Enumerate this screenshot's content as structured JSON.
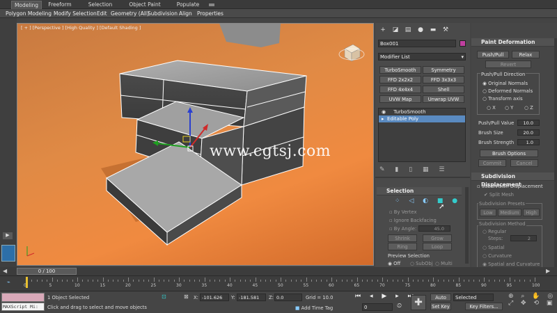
{
  "ribbon": {
    "tabs": [
      "Modeling",
      "Freeform",
      "Selection",
      "Object Paint",
      "Populate"
    ],
    "subtabs": [
      "Polygon Modeling",
      "Modify Selection",
      "Edit",
      "Geometry (All)",
      "Subdivision",
      "Align",
      "Properties"
    ]
  },
  "viewport": {
    "label": "[ + ] [Perspective ] [High Quality ] [Default Shading ]"
  },
  "watermark": "www.cgtsj.com",
  "command_panel": {
    "object_name": "Box001",
    "object_color": "#c040a0",
    "modifier_list": "Modifier List",
    "modifier_buttons": [
      "TurboSmooth",
      "Symmetry",
      "FFD 2x2x2",
      "FFD 3x3x3",
      "FFD 4x4x4",
      "Shell",
      "UVW Map",
      "Unwrap UVW"
    ],
    "stack": [
      "TurboSmooth",
      "Editable Poly"
    ],
    "selection": {
      "title": "Selection",
      "by_vertex": "By Vertex",
      "ignore_backfacing": "Ignore Backfacing",
      "by_angle": "By Angle:",
      "angle": "45.0",
      "shrink": "Shrink",
      "grow": "Grow",
      "ring": "Ring",
      "loop": "Loop",
      "preview": "Preview Selection",
      "preview_opts": [
        "Off",
        "SubObj",
        "Multi"
      ]
    }
  },
  "paint_deformation": {
    "title": "Paint Deformation",
    "push_pull": "Push/Pull",
    "relax": "Relax",
    "revert": "Revert",
    "direction": "Push/Pull Direction",
    "original": "Original Normals",
    "deformed": "Deformed Normals",
    "transform": "Transform axis",
    "axes": [
      "X",
      "Y",
      "Z"
    ],
    "value_label": "Push/Pull Value",
    "value": "10.0",
    "size_label": "Brush Size",
    "size": "20.0",
    "strength_label": "Brush Strength",
    "strength": "1.0",
    "options": "Brush Options",
    "commit": "Commit",
    "cancel": "Cancel"
  },
  "subdivision": {
    "title": "Subdivision Displacement",
    "check": "Subdivision Displacement",
    "split": "Split Mesh",
    "presets": "Subdivision Presets",
    "low": "Low",
    "medium": "Medium",
    "high": "High",
    "method": "Subdivision Method",
    "regular": "Regular",
    "steps_label": "Steps:",
    "steps": "2",
    "spatial": "Spatial",
    "curvature": "Curvature",
    "spatial_curv": "Spatial and Curvature"
  },
  "timeline": {
    "frame": "0 / 100",
    "ticks": [
      "0",
      "5",
      "10",
      "15",
      "20",
      "25",
      "30",
      "35",
      "40",
      "45",
      "50",
      "55",
      "60",
      "65",
      "70",
      "75",
      "80",
      "85",
      "90",
      "95",
      "100"
    ]
  },
  "status": {
    "script": "MAXScript Mi:",
    "objects": "1 Object Selected",
    "hint": "Click and drag to select and move objects",
    "x": "-101.626",
    "y": "-181.581",
    "z": "0.0",
    "grid": "Grid = 10.0",
    "add_time_tag": "Add Time Tag",
    "auto_key": "Auto Key",
    "set_key": "Set Key",
    "selected": "Selected",
    "key_filters": "Key Filters...",
    "frame_field": "0"
  }
}
